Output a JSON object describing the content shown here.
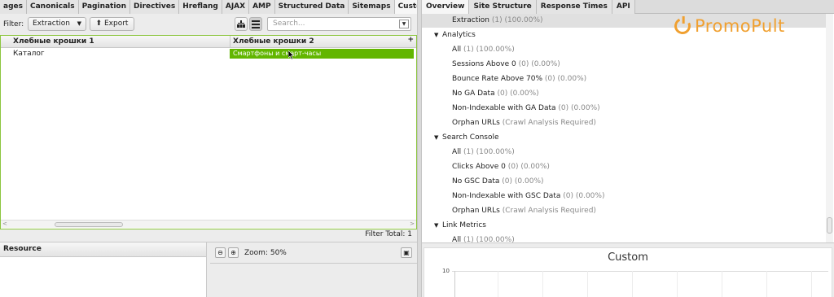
{
  "left_tabs": [
    "ages",
    "Canonicals",
    "Pagination",
    "Directives",
    "Hreflang",
    "AJAX",
    "AMP",
    "Structured Data",
    "Sitemaps",
    "Custom"
  ],
  "filter": {
    "label": "Filter:",
    "selected": "Extraction",
    "export_label": "Export",
    "search_placeholder": "Search..."
  },
  "table": {
    "columns": [
      "Хлебные крошки 1",
      "Хлебные крошки 2"
    ],
    "rows": [
      [
        "Каталог",
        "Смартфоны и смарт-часы"
      ]
    ]
  },
  "filter_total": "Filter Total:  1",
  "resource": {
    "label": "Resource"
  },
  "zoom": {
    "label": "Zoom: 50%"
  },
  "right_tabs": [
    "Overview",
    "Site Structure",
    "Response Times",
    "API"
  ],
  "overview": [
    {
      "name": "Extraction",
      "stat": "(1) (100.00%)",
      "level": 2,
      "selected": true
    },
    {
      "name": "Analytics",
      "stat": "",
      "level": 1
    },
    {
      "name": "All",
      "stat": "(1) (100.00%)",
      "level": 2
    },
    {
      "name": "Sessions Above 0",
      "stat": "(0) (0.00%)",
      "level": 2
    },
    {
      "name": "Bounce Rate Above 70%",
      "stat": "(0) (0.00%)",
      "level": 2
    },
    {
      "name": "No GA Data",
      "stat": "(0) (0.00%)",
      "level": 2
    },
    {
      "name": "Non-Indexable with GA Data",
      "stat": "(0) (0.00%)",
      "level": 2
    },
    {
      "name": "Orphan URLs",
      "stat": "(Crawl Analysis Required)",
      "level": 2
    },
    {
      "name": "Search Console",
      "stat": "",
      "level": 1
    },
    {
      "name": "All",
      "stat": "(1) (100.00%)",
      "level": 2
    },
    {
      "name": "Clicks Above 0",
      "stat": "(0) (0.00%)",
      "level": 2
    },
    {
      "name": "No GSC Data",
      "stat": "(0) (0.00%)",
      "level": 2
    },
    {
      "name": "Non-Indexable with GSC Data",
      "stat": "(0) (0.00%)",
      "level": 2
    },
    {
      "name": "Orphan URLs",
      "stat": "(Crawl Analysis Required)",
      "level": 2
    },
    {
      "name": "Link Metrics",
      "stat": "",
      "level": 1
    },
    {
      "name": "All",
      "stat": "(1) (100.00%)",
      "level": 2
    }
  ],
  "logo": {
    "text": "PromoPult"
  },
  "chart": {
    "title": "Custom",
    "ytick": "10"
  },
  "colors": {
    "accent": "#62b600",
    "logo": "#f0a030"
  }
}
